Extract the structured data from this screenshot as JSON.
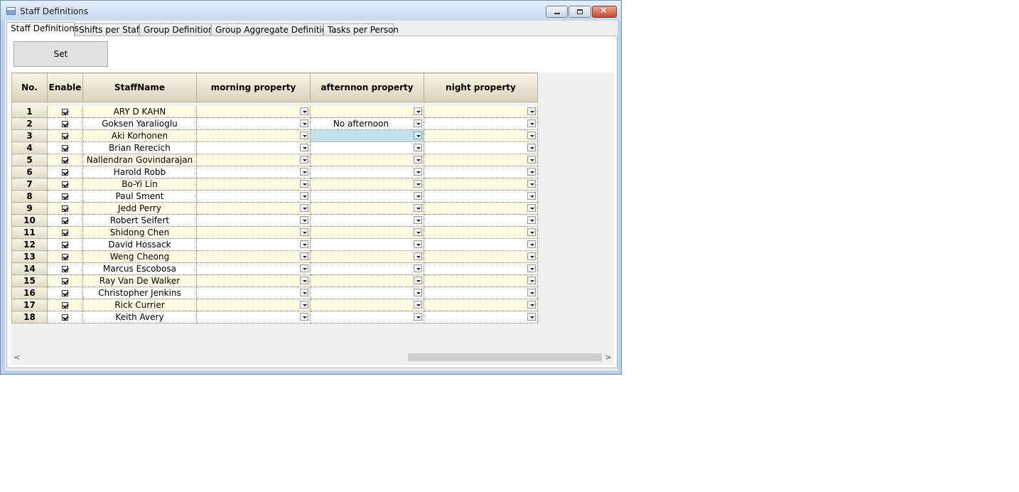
{
  "window": {
    "title": "Staff Definitions"
  },
  "tabs": [
    {
      "label": "Staff Definitions",
      "active": true
    },
    {
      "label": "Shifts per Staff",
      "active": false
    },
    {
      "label": "Group Definitions",
      "active": false
    },
    {
      "label": "Group Aggregate Definitions",
      "active": false
    },
    {
      "label": "Tasks per Person",
      "active": false
    }
  ],
  "set_button": {
    "label": "Set"
  },
  "grid": {
    "columns": [
      "No.",
      "Enable",
      "StaffName",
      "morning property",
      "afternnon property",
      "night property"
    ],
    "rows": [
      {
        "no": "1",
        "enabled": true,
        "name": "ARY D KAHN",
        "morning": "",
        "afternoon": "",
        "night": ""
      },
      {
        "no": "2",
        "enabled": true,
        "name": "Goksen Yaralioglu",
        "morning": "",
        "afternoon": "No afternoon",
        "night": ""
      },
      {
        "no": "3",
        "enabled": true,
        "name": "Aki Korhonen",
        "morning": "",
        "afternoon": "",
        "night": ""
      },
      {
        "no": "4",
        "enabled": true,
        "name": "Brian Rerecich",
        "morning": "",
        "afternoon": "",
        "night": ""
      },
      {
        "no": "5",
        "enabled": true,
        "name": "Nallendran Govindarajan",
        "morning": "",
        "afternoon": "",
        "night": ""
      },
      {
        "no": "6",
        "enabled": true,
        "name": "Harold Robb",
        "morning": "",
        "afternoon": "",
        "night": ""
      },
      {
        "no": "7",
        "enabled": true,
        "name": "Bo-Yi Lin",
        "morning": "",
        "afternoon": "",
        "night": ""
      },
      {
        "no": "8",
        "enabled": true,
        "name": "Paul Sment",
        "morning": "",
        "afternoon": "",
        "night": ""
      },
      {
        "no": "9",
        "enabled": true,
        "name": "Jedd Perry",
        "morning": "",
        "afternoon": "",
        "night": ""
      },
      {
        "no": "10",
        "enabled": true,
        "name": "Robert Seifert",
        "morning": "",
        "afternoon": "",
        "night": ""
      },
      {
        "no": "11",
        "enabled": true,
        "name": "Shidong Chen",
        "morning": "",
        "afternoon": "",
        "night": ""
      },
      {
        "no": "12",
        "enabled": true,
        "name": "David Hossack",
        "morning": "",
        "afternoon": "",
        "night": ""
      },
      {
        "no": "13",
        "enabled": true,
        "name": "Weng Cheong",
        "morning": "",
        "afternoon": "",
        "night": ""
      },
      {
        "no": "14",
        "enabled": true,
        "name": "Marcus Escobosa",
        "morning": "",
        "afternoon": "",
        "night": ""
      },
      {
        "no": "15",
        "enabled": true,
        "name": "Ray Van De Walker",
        "morning": "",
        "afternoon": "",
        "night": ""
      },
      {
        "no": "16",
        "enabled": true,
        "name": "Christopher Jenkins",
        "morning": "",
        "afternoon": "",
        "night": ""
      },
      {
        "no": "17",
        "enabled": true,
        "name": "Rick Currier",
        "morning": "",
        "afternoon": "",
        "night": ""
      },
      {
        "no": "18",
        "enabled": true,
        "name": "Keith Avery",
        "morning": "",
        "afternoon": "",
        "night": ""
      }
    ],
    "selected_cell": {
      "row": 2,
      "column": "afternoon"
    }
  },
  "colors": {
    "row_alt": "#fdfde6",
    "header_gradient_top": "#f8f5e6",
    "header_gradient_bottom": "#d9d3bb",
    "selection": "#c5e0ea",
    "close_button": "#c74a31"
  },
  "icons": [
    "window-app-icon",
    "minimize-icon",
    "maximize-icon",
    "close-icon",
    "checkbox-checked-icon",
    "dropdown-arrow-icon",
    "scroll-left-icon",
    "scroll-right-icon"
  ]
}
